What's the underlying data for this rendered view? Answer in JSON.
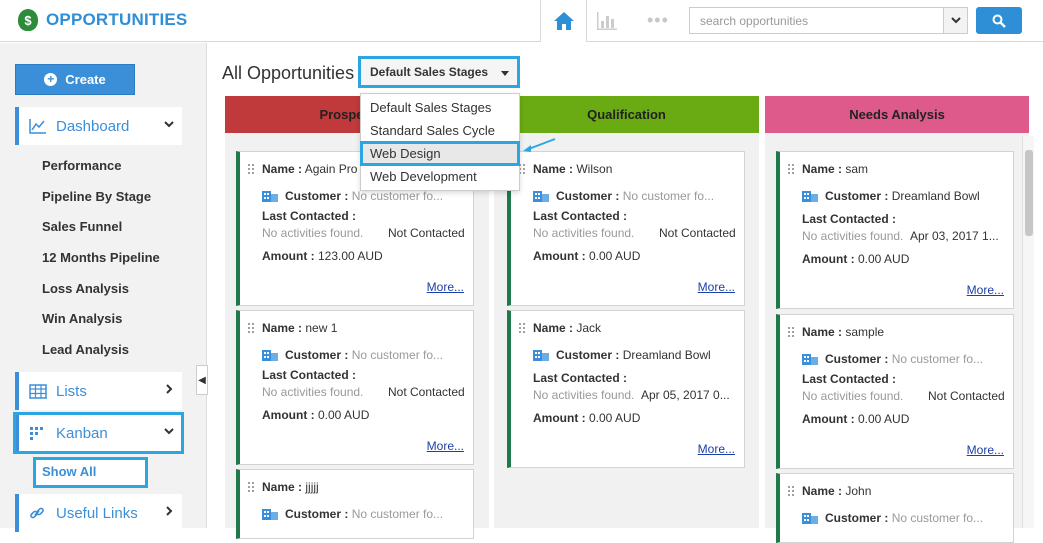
{
  "app": {
    "title": "OPPORTUNITIES",
    "brand_color": "#2e8fd6",
    "icon": "money-bag-icon"
  },
  "search": {
    "placeholder": "search opportunities"
  },
  "sidebar": {
    "create_label": "Create",
    "dashboard_label": "Dashboard",
    "dashboard_items": [
      "Performance",
      "Pipeline By Stage",
      "Sales Funnel",
      "12 Months Pipeline",
      "Loss Analysis",
      "Win Analysis",
      "Lead Analysis"
    ],
    "lists_label": "Lists",
    "kanban_label": "Kanban",
    "show_all_label": "Show All",
    "useful_links_label": "Useful Links"
  },
  "main": {
    "title": "All Opportunities",
    "stage_selected": "Default Sales Stages",
    "stage_options": [
      "Default Sales Stages",
      "Standard Sales Cycle",
      "Web Design",
      "Web Development"
    ],
    "stage_highlighted": "Web Design"
  },
  "labels": {
    "name": "Name :",
    "customer": "Customer :",
    "last_contacted": "Last Contacted :",
    "amount": "Amount :",
    "more": "More..."
  },
  "columns": [
    {
      "title": "Prospecting",
      "color": "#c0393b",
      "cards": [
        {
          "name": "Again Pro",
          "customer": "No customer fo...",
          "activity": "No activities found.",
          "status": "Not Contacted",
          "amount": "123.00 AUD"
        },
        {
          "name": "new 1",
          "customer": "No customer fo...",
          "activity": "No activities found.",
          "status": "Not Contacted",
          "amount": "0.00 AUD"
        },
        {
          "name": "jjjjj",
          "customer": "No customer fo..."
        }
      ]
    },
    {
      "title": "Qualification",
      "color": "#6aaa12",
      "cards": [
        {
          "name": "Wilson",
          "customer": "No customer fo...",
          "activity": "No activities found.",
          "status": "Not Contacted",
          "amount": "0.00 AUD"
        },
        {
          "name": "Jack",
          "customer": "Dreamland Bowl",
          "activity": "No activities found.",
          "status": "Apr 05, 2017 0...",
          "amount": "0.00 AUD"
        }
      ]
    },
    {
      "title": "Needs Analysis",
      "color": "#de5a8a",
      "cards": [
        {
          "name": "sam",
          "customer": "Dreamland Bowl",
          "activity": "No activities found.",
          "status": "Apr 03, 2017 1...",
          "amount": "0.00 AUD"
        },
        {
          "name": "sample",
          "customer": "No customer fo...",
          "activity": "No activities found.",
          "status": "Not Contacted",
          "amount": "0.00 AUD"
        },
        {
          "name": "John",
          "customer": "No customer fo..."
        }
      ]
    }
  ]
}
